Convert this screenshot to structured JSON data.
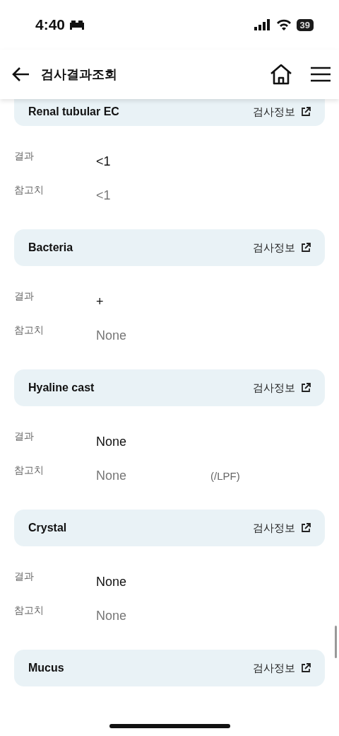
{
  "status_bar": {
    "time": "4:40",
    "battery": "39"
  },
  "header": {
    "title": "검사결과조회"
  },
  "tests": [
    {
      "name": "Renal tubular EC",
      "info_link": "검사정보",
      "clipped": true,
      "rows": [
        {
          "label": "결과",
          "value": "<1",
          "kind": "result"
        },
        {
          "label": "참고치",
          "value": "<1",
          "kind": "reference"
        }
      ]
    },
    {
      "name": "Bacteria",
      "info_link": "검사정보",
      "clipped": false,
      "rows": [
        {
          "label": "결과",
          "value": "+",
          "kind": "result"
        },
        {
          "label": "참고치",
          "value": "None",
          "kind": "reference"
        }
      ]
    },
    {
      "name": "Hyaline cast",
      "info_link": "검사정보",
      "clipped": false,
      "rows": [
        {
          "label": "결과",
          "value": "None",
          "kind": "result"
        },
        {
          "label": "참고치",
          "value": "None",
          "kind": "reference",
          "unit": "(/LPF)"
        }
      ]
    },
    {
      "name": "Crystal",
      "info_link": "검사정보",
      "clipped": false,
      "rows": [
        {
          "label": "결과",
          "value": "None",
          "kind": "result"
        },
        {
          "label": "참고치",
          "value": "None",
          "kind": "reference"
        }
      ]
    },
    {
      "name": "Mucus",
      "info_link": "검사정보",
      "clipped": false
    }
  ]
}
